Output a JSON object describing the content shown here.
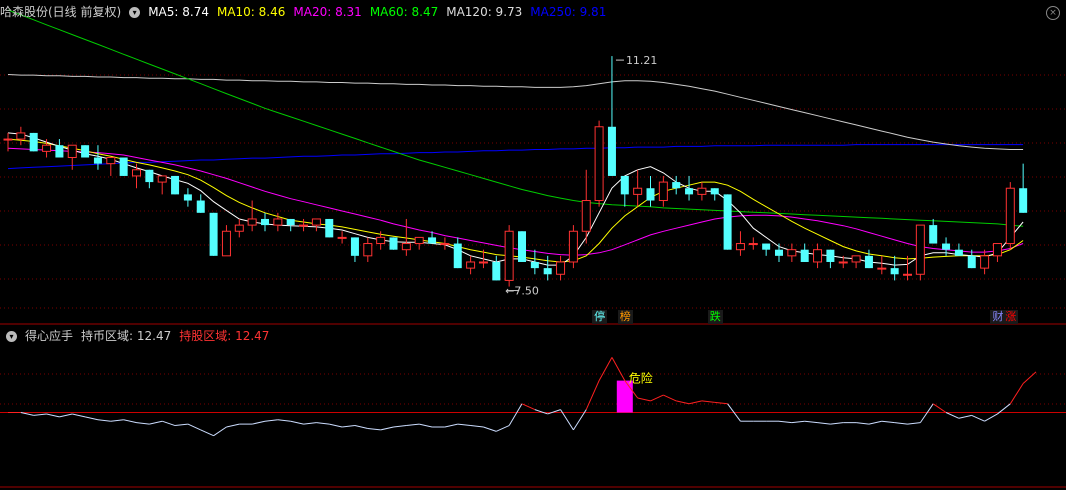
{
  "main_header": {
    "stock": "哈森股份(日线 前复权)",
    "ma": [
      {
        "label": "MA5: 8.74",
        "color": "#ffffff"
      },
      {
        "label": "MA10: 8.46",
        "color": "#ffff00"
      },
      {
        "label": "MA20: 8.31",
        "color": "#ff00ff"
      },
      {
        "label": "MA60: 8.47",
        "color": "#00ff00"
      },
      {
        "label": "MA120: 9.73",
        "color": "#dddddd"
      },
      {
        "label": "MA250: 9.81",
        "color": "#0000ff"
      }
    ]
  },
  "sub_header": {
    "indicator": "得心应手",
    "coin_label": "持币区域: 12.47",
    "stock_label": "持股区域: 12.47"
  },
  "chart_data": [
    {
      "type": "candlestick",
      "y_range": [
        7.2,
        12.0
      ],
      "high_annotation": "11.21",
      "low_annotation": "7.50",
      "candles": [
        [
          9.9,
          10.0,
          9.7,
          9.9
        ],
        [
          9.9,
          10.1,
          9.8,
          10.0
        ],
        [
          10.0,
          10.0,
          9.7,
          9.7
        ],
        [
          9.7,
          9.9,
          9.6,
          9.8
        ],
        [
          9.8,
          9.9,
          9.6,
          9.6
        ],
        [
          9.6,
          9.8,
          9.4,
          9.8
        ],
        [
          9.8,
          9.8,
          9.6,
          9.6
        ],
        [
          9.6,
          9.8,
          9.4,
          9.5
        ],
        [
          9.5,
          9.6,
          9.3,
          9.6
        ],
        [
          9.6,
          9.6,
          9.3,
          9.3
        ],
        [
          9.3,
          9.5,
          9.1,
          9.4
        ],
        [
          9.4,
          9.4,
          9.1,
          9.2
        ],
        [
          9.2,
          9.3,
          9.0,
          9.3
        ],
        [
          9.3,
          9.3,
          9.0,
          9.0
        ],
        [
          9.0,
          9.1,
          8.8,
          8.9
        ],
        [
          8.9,
          9.0,
          8.7,
          8.7
        ],
        [
          8.7,
          8.7,
          8.0,
          8.0
        ],
        [
          8.0,
          8.5,
          8.0,
          8.4
        ],
        [
          8.4,
          8.6,
          8.3,
          8.5
        ],
        [
          8.5,
          8.9,
          8.4,
          8.6
        ],
        [
          8.6,
          8.7,
          8.4,
          8.5
        ],
        [
          8.5,
          8.7,
          8.4,
          8.6
        ],
        [
          8.6,
          8.6,
          8.4,
          8.5
        ],
        [
          8.5,
          8.6,
          8.4,
          8.5
        ],
        [
          8.5,
          8.6,
          8.4,
          8.6
        ],
        [
          8.6,
          8.6,
          8.3,
          8.3
        ],
        [
          8.3,
          8.4,
          8.2,
          8.3
        ],
        [
          8.3,
          8.3,
          7.9,
          8.0
        ],
        [
          8.0,
          8.3,
          7.9,
          8.2
        ],
        [
          8.2,
          8.4,
          8.1,
          8.3
        ],
        [
          8.3,
          8.3,
          8.1,
          8.1
        ],
        [
          8.1,
          8.6,
          8.0,
          8.2
        ],
        [
          8.2,
          8.3,
          8.1,
          8.3
        ],
        [
          8.3,
          8.4,
          8.2,
          8.2
        ],
        [
          8.2,
          8.3,
          8.1,
          8.2
        ],
        [
          8.2,
          8.3,
          7.8,
          7.8
        ],
        [
          7.8,
          8.0,
          7.7,
          7.9
        ],
        [
          7.9,
          8.1,
          7.8,
          7.9
        ],
        [
          7.9,
          8.0,
          7.6,
          7.6
        ],
        [
          7.6,
          8.5,
          7.5,
          8.4
        ],
        [
          8.4,
          8.4,
          7.9,
          7.9
        ],
        [
          7.9,
          8.1,
          7.7,
          7.8
        ],
        [
          7.8,
          8.0,
          7.6,
          7.7
        ],
        [
          7.7,
          8.0,
          7.6,
          7.9
        ],
        [
          7.9,
          8.5,
          7.8,
          8.4
        ],
        [
          8.4,
          9.4,
          8.2,
          8.9
        ],
        [
          8.9,
          10.2,
          8.8,
          10.1
        ],
        [
          10.1,
          11.25,
          9.3,
          9.3
        ],
        [
          9.3,
          9.3,
          8.8,
          9.0
        ],
        [
          9.0,
          9.4,
          8.8,
          9.1
        ],
        [
          9.1,
          9.3,
          8.8,
          8.9
        ],
        [
          8.9,
          9.3,
          8.8,
          9.2
        ],
        [
          9.2,
          9.3,
          9.0,
          9.1
        ],
        [
          9.1,
          9.3,
          8.9,
          9.0
        ],
        [
          9.0,
          9.2,
          8.9,
          9.1
        ],
        [
          9.1,
          9.1,
          8.9,
          9.0
        ],
        [
          9.0,
          9.0,
          8.1,
          8.1
        ],
        [
          8.1,
          8.4,
          8.0,
          8.2
        ],
        [
          8.2,
          8.3,
          8.1,
          8.2
        ],
        [
          8.2,
          8.2,
          8.0,
          8.1
        ],
        [
          8.1,
          8.2,
          7.9,
          8.0
        ],
        [
          8.0,
          8.2,
          7.9,
          8.1
        ],
        [
          8.1,
          8.2,
          7.9,
          7.9
        ],
        [
          7.9,
          8.2,
          7.8,
          8.1
        ],
        [
          8.1,
          8.1,
          7.8,
          7.9
        ],
        [
          7.9,
          8.0,
          7.8,
          7.9
        ],
        [
          7.9,
          8.0,
          7.8,
          8.0
        ],
        [
          8.0,
          8.1,
          7.8,
          7.8
        ],
        [
          7.8,
          8.0,
          7.7,
          7.8
        ],
        [
          7.8,
          8.0,
          7.6,
          7.7
        ],
        [
          7.7,
          8.0,
          7.6,
          7.7
        ],
        [
          7.7,
          8.5,
          7.6,
          8.5
        ],
        [
          8.5,
          8.6,
          8.2,
          8.2
        ],
        [
          8.2,
          8.3,
          8.0,
          8.1
        ],
        [
          8.1,
          8.2,
          8.0,
          8.0
        ],
        [
          8.0,
          8.1,
          7.8,
          7.8
        ],
        [
          7.8,
          8.1,
          7.7,
          8.0
        ],
        [
          8.0,
          8.2,
          7.9,
          8.2
        ],
        [
          8.2,
          9.2,
          8.1,
          9.1
        ],
        [
          9.1,
          9.5,
          8.7,
          8.7
        ]
      ],
      "ma5": [
        10.0,
        9.98,
        9.92,
        9.85,
        9.78,
        9.72,
        9.66,
        9.62,
        9.57,
        9.5,
        9.43,
        9.37,
        9.3,
        9.24,
        9.18,
        9.06,
        8.88,
        8.74,
        8.6,
        8.55,
        8.52,
        8.5,
        8.49,
        8.48,
        8.47,
        8.45,
        8.42,
        8.36,
        8.3,
        8.26,
        8.23,
        8.22,
        8.22,
        8.2,
        8.18,
        8.1,
        8.0,
        7.95,
        7.9,
        7.95,
        7.95,
        7.9,
        7.85,
        7.85,
        8.0,
        8.3,
        8.7,
        9.1,
        9.3,
        9.4,
        9.45,
        9.35,
        9.2,
        9.1,
        9.05,
        9.05,
        8.9,
        8.7,
        8.45,
        8.3,
        8.15,
        8.08,
        8.05,
        8.02,
        8.0,
        7.97,
        7.95,
        7.9,
        7.88,
        7.85,
        7.86,
        8.0,
        8.05,
        8.05,
        8.02,
        8.0,
        7.98,
        8.05,
        8.3,
        8.55
      ],
      "ma10": [
        9.9,
        9.88,
        9.86,
        9.83,
        9.79,
        9.75,
        9.71,
        9.66,
        9.62,
        9.57,
        9.52,
        9.48,
        9.43,
        9.38,
        9.32,
        9.23,
        9.11,
        8.98,
        8.87,
        8.78,
        8.7,
        8.64,
        8.58,
        8.55,
        8.52,
        8.5,
        8.47,
        8.43,
        8.39,
        8.35,
        8.32,
        8.29,
        8.26,
        8.23,
        8.2,
        8.15,
        8.1,
        8.06,
        8.02,
        8.0,
        7.98,
        7.95,
        7.92,
        7.9,
        7.92,
        8.0,
        8.2,
        8.45,
        8.65,
        8.8,
        8.95,
        9.05,
        9.1,
        9.15,
        9.2,
        9.2,
        9.15,
        9.05,
        8.92,
        8.8,
        8.68,
        8.56,
        8.45,
        8.35,
        8.25,
        8.15,
        8.08,
        8.03,
        8.0,
        7.97,
        7.95,
        7.96,
        7.98,
        7.99,
        8.0,
        8.0,
        8.0,
        8.02,
        8.1,
        8.25
      ],
      "ma20": [
        9.75,
        9.74,
        9.73,
        9.72,
        9.71,
        9.7,
        9.69,
        9.68,
        9.66,
        9.64,
        9.6,
        9.56,
        9.52,
        9.48,
        9.43,
        9.38,
        9.32,
        9.26,
        9.19,
        9.12,
        9.05,
        8.99,
        8.93,
        8.88,
        8.83,
        8.78,
        8.73,
        8.68,
        8.63,
        8.58,
        8.52,
        8.47,
        8.42,
        8.38,
        8.33,
        8.29,
        8.25,
        8.21,
        8.17,
        8.13,
        8.1,
        8.07,
        8.04,
        8.02,
        8.01,
        8.02,
        8.05,
        8.1,
        8.18,
        8.26,
        8.34,
        8.4,
        8.45,
        8.5,
        8.55,
        8.6,
        8.63,
        8.65,
        8.66,
        8.66,
        8.65,
        8.63,
        8.6,
        8.57,
        8.53,
        8.49,
        8.44,
        8.38,
        8.32,
        8.26,
        8.2,
        8.15,
        8.12,
        8.1,
        8.08,
        8.06,
        8.06,
        8.08,
        8.12,
        8.2
      ],
      "ma60": [
        12.0,
        11.92,
        11.84,
        11.76,
        11.68,
        11.6,
        11.52,
        11.44,
        11.36,
        11.28,
        11.2,
        11.12,
        11.04,
        10.96,
        10.88,
        10.8,
        10.72,
        10.64,
        10.56,
        10.48,
        10.4,
        10.33,
        10.26,
        10.19,
        10.12,
        10.05,
        9.98,
        9.91,
        9.84,
        9.77,
        9.7,
        9.63,
        9.56,
        9.5,
        9.44,
        9.38,
        9.32,
        9.26,
        9.2,
        9.14,
        9.08,
        9.03,
        8.98,
        8.94,
        8.9,
        8.87,
        8.85,
        8.83,
        8.82,
        8.81,
        8.8,
        8.78,
        8.77,
        8.76,
        8.75,
        8.74,
        8.73,
        8.72,
        8.71,
        8.7,
        8.69,
        8.68,
        8.67,
        8.66,
        8.65,
        8.64,
        8.63,
        8.62,
        8.61,
        8.6,
        8.59,
        8.58,
        8.57,
        8.56,
        8.55,
        8.54,
        8.53,
        8.52,
        8.5,
        8.48
      ],
      "ma120": [
        10.95,
        10.94,
        10.94,
        10.93,
        10.93,
        10.92,
        10.92,
        10.91,
        10.91,
        10.9,
        10.9,
        10.89,
        10.89,
        10.88,
        10.88,
        10.87,
        10.87,
        10.86,
        10.86,
        10.85,
        10.85,
        10.84,
        10.84,
        10.83,
        10.83,
        10.82,
        10.82,
        10.81,
        10.81,
        10.8,
        10.8,
        10.79,
        10.79,
        10.78,
        10.78,
        10.77,
        10.77,
        10.76,
        10.76,
        10.75,
        10.75,
        10.74,
        10.74,
        10.74,
        10.75,
        10.77,
        10.8,
        10.83,
        10.85,
        10.85,
        10.84,
        10.82,
        10.79,
        10.76,
        10.72,
        10.68,
        10.63,
        10.58,
        10.53,
        10.48,
        10.43,
        10.38,
        10.33,
        10.28,
        10.23,
        10.18,
        10.13,
        10.08,
        10.03,
        9.98,
        9.93,
        9.89,
        9.85,
        9.82,
        9.79,
        9.77,
        9.75,
        9.74,
        9.73,
        9.73
      ],
      "ma250": [
        9.42,
        9.43,
        9.44,
        9.45,
        9.46,
        9.47,
        9.48,
        9.49,
        9.5,
        9.51,
        9.52,
        9.52,
        9.53,
        9.54,
        9.55,
        9.56,
        9.56,
        9.57,
        9.58,
        9.59,
        9.59,
        9.6,
        9.61,
        9.62,
        9.62,
        9.63,
        9.64,
        9.64,
        9.65,
        9.66,
        9.66,
        9.67,
        9.68,
        9.68,
        9.69,
        9.69,
        9.7,
        9.71,
        9.71,
        9.72,
        9.72,
        9.73,
        9.73,
        9.74,
        9.74,
        9.75,
        9.75,
        9.76,
        9.76,
        9.77,
        9.77,
        9.77,
        9.78,
        9.78,
        9.78,
        9.79,
        9.79,
        9.79,
        9.79,
        9.8,
        9.8,
        9.8,
        9.8,
        9.8,
        9.8,
        9.8,
        9.81,
        9.81,
        9.81,
        9.81,
        9.81,
        9.81,
        9.81,
        9.81,
        9.81,
        9.81,
        9.81,
        9.81,
        9.81,
        9.81
      ],
      "markers": [
        {
          "index": 46,
          "text": "停",
          "color": "#66ffff"
        },
        {
          "index": 48,
          "text": "榜",
          "color": "#ff9900"
        },
        {
          "index": 55,
          "text": "跌",
          "color": "#00ff00"
        },
        {
          "index": 77,
          "text": "财",
          "color": "#8888ff"
        },
        {
          "index": 78,
          "text": "涨",
          "color": "#ff0000"
        }
      ]
    },
    {
      "type": "line",
      "y_range": [
        0,
        100
      ],
      "danger_label": "危险",
      "level": 50,
      "line": [
        50,
        50,
        48,
        49,
        47,
        49,
        47,
        45,
        44,
        45,
        43,
        42,
        44,
        41,
        42,
        38,
        34,
        40,
        42,
        42,
        44,
        45,
        44,
        42,
        43,
        42,
        40,
        41,
        39,
        38,
        40,
        41,
        42,
        40,
        40,
        42,
        41,
        40,
        37,
        41,
        56,
        52,
        49,
        52,
        38,
        52,
        72,
        88,
        72,
        60,
        58,
        62,
        58,
        56,
        58,
        57,
        56,
        44,
        44,
        44,
        44,
        43,
        44,
        43,
        42,
        43,
        43,
        42,
        44,
        43,
        42,
        43,
        56,
        50,
        46,
        48,
        44,
        49,
        56,
        70,
        78
      ],
      "magenta_bar": {
        "index": 48,
        "top": 72,
        "bottom": 50
      }
    }
  ]
}
